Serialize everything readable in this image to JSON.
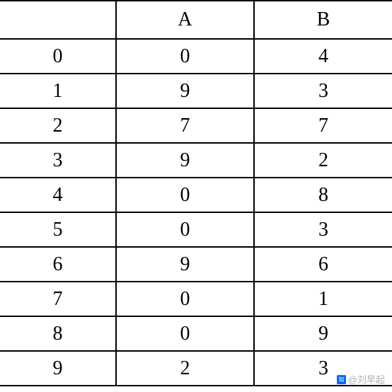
{
  "chart_data": {
    "type": "table",
    "columns": [
      "",
      "A",
      "B"
    ],
    "index": [
      0,
      1,
      2,
      3,
      4,
      5,
      6,
      7,
      8,
      9
    ],
    "data": {
      "A": [
        0,
        9,
        7,
        9,
        0,
        0,
        9,
        0,
        0,
        2
      ],
      "B": [
        4,
        3,
        7,
        2,
        8,
        3,
        6,
        1,
        9,
        3
      ]
    }
  },
  "header": {
    "idx": "",
    "colA": "A",
    "colB": "B"
  },
  "rows": [
    {
      "idx": "0",
      "a": "0",
      "b": "4"
    },
    {
      "idx": "1",
      "a": "9",
      "b": "3"
    },
    {
      "idx": "2",
      "a": "7",
      "b": "7"
    },
    {
      "idx": "3",
      "a": "9",
      "b": "2"
    },
    {
      "idx": "4",
      "a": "0",
      "b": "8"
    },
    {
      "idx": "5",
      "a": "0",
      "b": "3"
    },
    {
      "idx": "6",
      "a": "9",
      "b": "6"
    },
    {
      "idx": "7",
      "a": "0",
      "b": "1"
    },
    {
      "idx": "8",
      "a": "0",
      "b": "9"
    },
    {
      "idx": "9",
      "a": "2",
      "b": "3"
    }
  ],
  "watermark": {
    "text": "@刘早起"
  }
}
